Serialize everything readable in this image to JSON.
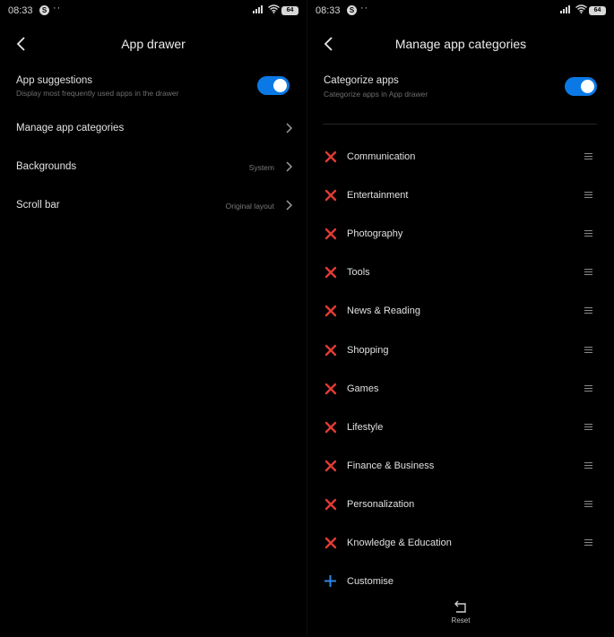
{
  "status_bar": {
    "time": "08:33",
    "app_badge": "S",
    "dots": "··",
    "battery": "64"
  },
  "left": {
    "title": "App drawer",
    "settings": [
      {
        "label": "App suggestions",
        "sub": "Display most frequently used apps in the drawer",
        "toggle": true
      },
      {
        "label": "Manage app categories"
      },
      {
        "label": "Backgrounds",
        "value": "System"
      },
      {
        "label": "Scroll bar",
        "value": "Original layout"
      }
    ]
  },
  "right": {
    "title": "Manage app categories",
    "categorize": {
      "label": "Categorize apps",
      "sub": "Categorize apps in App drawer",
      "toggle": true
    },
    "categories": [
      "Communication",
      "Entertainment",
      "Photography",
      "Tools",
      "News & Reading",
      "Shopping",
      "Games",
      "Lifestyle",
      "Finance & Business",
      "Personalization",
      "Knowledge & Education"
    ],
    "customise_label": "Customise",
    "reset_label": "Reset"
  },
  "colors": {
    "accent": "#0a79e5",
    "delete": "#e23b35",
    "background": "#000000"
  }
}
